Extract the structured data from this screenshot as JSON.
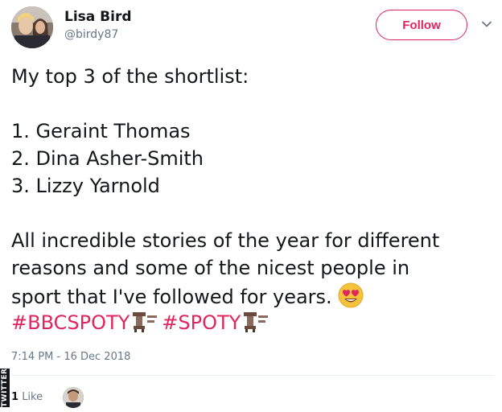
{
  "author": {
    "display_name": "Lisa Bird",
    "handle": "@birdy87"
  },
  "actions": {
    "follow_label": "Follow"
  },
  "tweet": {
    "lines": [
      "My top 3 of the shortlist:",
      "",
      "1. Geraint Thomas",
      "2. Dina Asher-Smith",
      "3. Lizzy Yarnold",
      "",
      "All incredible stories of the year for different",
      "reasons and some of the nicest people in",
      "sport that I've followed for years."
    ],
    "hashtags": [
      "#BBCSPOTY",
      "#SPOTY"
    ],
    "emoji": "heart-eyes-emoji"
  },
  "meta": {
    "timestamp": "7:14 PM - 16 Dec 2018",
    "like_count": "1",
    "like_label": "Like"
  },
  "watermark": "TWITTER",
  "colors": {
    "accent": "#e0245e",
    "text": "#14171a",
    "muted": "#657786",
    "divider": "#e6ecf0"
  }
}
